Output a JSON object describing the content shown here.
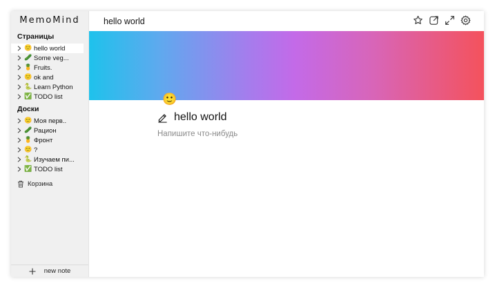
{
  "app": {
    "logo": "MemoMind"
  },
  "sidebar": {
    "pages_title": "Страницы",
    "pages": [
      {
        "emoji": "🙂",
        "label": "hello world",
        "active": true
      },
      {
        "emoji": "🥒",
        "label": "Some veg...",
        "active": false
      },
      {
        "emoji": "🍍",
        "label": "Fruits.",
        "active": false
      },
      {
        "emoji": "🙂",
        "label": "ok and",
        "active": false
      },
      {
        "emoji": "🐍",
        "label": "Learn Python",
        "active": false
      },
      {
        "emoji": "✅",
        "label": "TODO list",
        "active": false
      }
    ],
    "boards_title": "Доски",
    "boards": [
      {
        "emoji": "🙂",
        "label": "Моя перв..",
        "active": false
      },
      {
        "emoji": "🥒",
        "label": "Рацион",
        "active": false
      },
      {
        "emoji": "🍍",
        "label": "Фронт",
        "active": false
      },
      {
        "emoji": "🙂",
        "label": "?",
        "active": false
      },
      {
        "emoji": "🐍",
        "label": "Изучаем пи...",
        "active": false
      },
      {
        "emoji": "✅",
        "label": "TODO list",
        "active": false
      }
    ],
    "trash_label": "Корзина",
    "new_note_label": "new note"
  },
  "topbar": {
    "title": "hello world",
    "icons": [
      "star-icon",
      "open-external-icon",
      "expand-icon",
      "settings-icon"
    ]
  },
  "page": {
    "emoji": "🙂",
    "title": "hello world",
    "placeholder": "Напишите что-нибудь"
  },
  "colors": {
    "sidebar_bg": "#f0f0f0",
    "cover_gradient": [
      "#1ec2ec",
      "#c36ae8",
      "#f4525c"
    ],
    "placeholder_text": "#8a8a8a"
  }
}
